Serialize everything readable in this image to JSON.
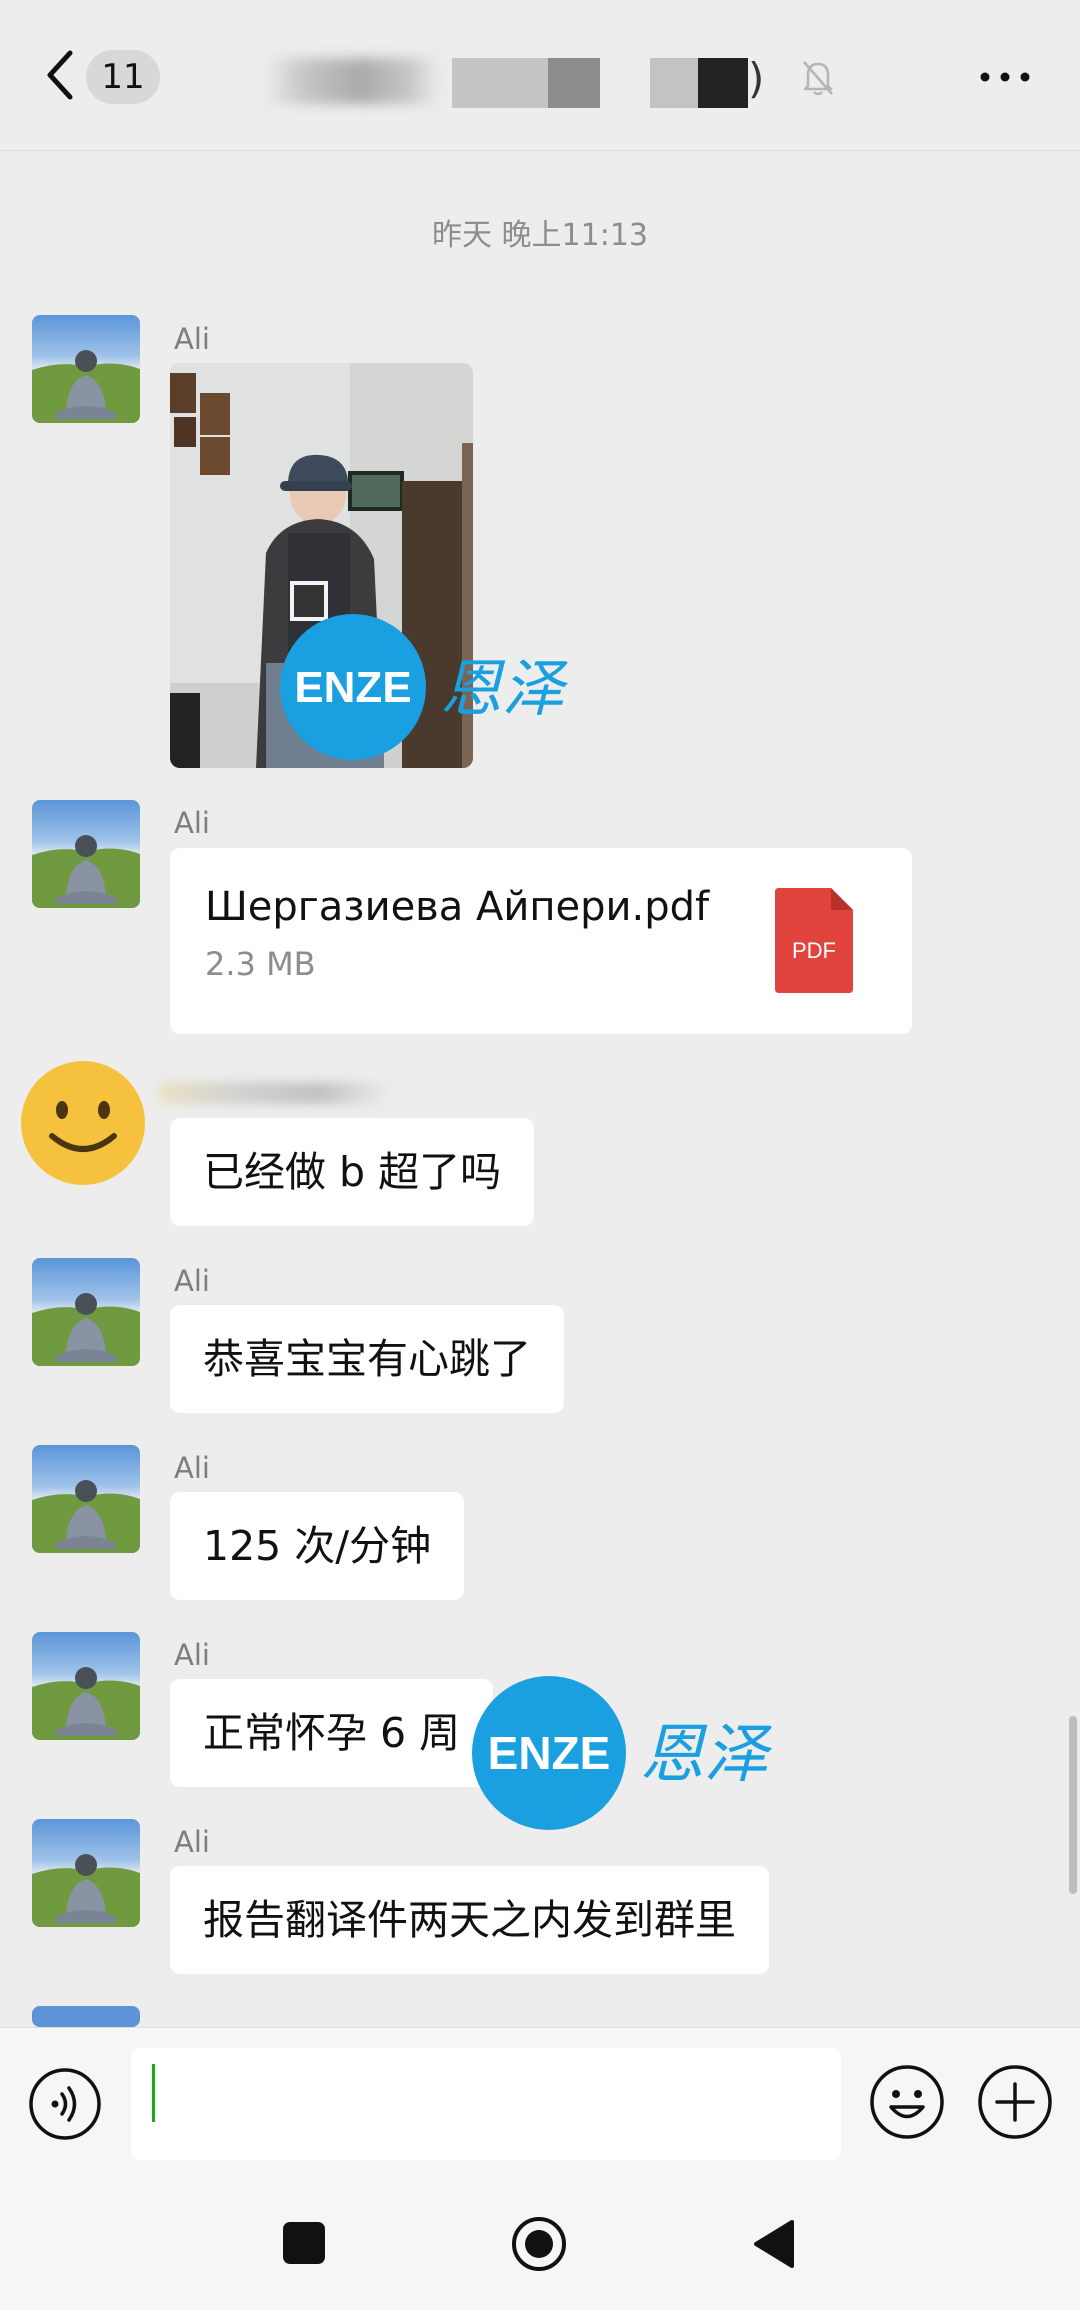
{
  "header": {
    "unread_count": "11",
    "title_suffix": ")"
  },
  "timestamp": "昨天 晚上11:13",
  "messages": [
    {
      "sender": "Ali",
      "type": "image"
    },
    {
      "sender": "Ali",
      "type": "file",
      "file_name": "Шергазиева Айпери.pdf",
      "file_size": "2.3 MB",
      "file_type": "PDF"
    },
    {
      "sender": "",
      "type": "text",
      "text": "已经做 b 超了吗"
    },
    {
      "sender": "Ali",
      "type": "text",
      "text": "恭喜宝宝有心跳了"
    },
    {
      "sender": "Ali",
      "type": "text",
      "text": "125 次/分钟"
    },
    {
      "sender": "Ali",
      "type": "text",
      "text": "正常怀孕 6 周"
    },
    {
      "sender": "Ali",
      "type": "text",
      "text": "报告翻译件两天之内发到群里"
    },
    {
      "sender": "Ali",
      "type": "partial"
    }
  ],
  "watermark": {
    "badge": "ENZE",
    "text": "恩泽",
    "badge_color": "#1a9fe0"
  },
  "input": {
    "value": ""
  },
  "icons": {
    "back": "chevron-left-icon",
    "mute": "bell-off-icon",
    "more": "more-dots-icon",
    "voice": "voice-icon",
    "emoji": "emoji-icon",
    "plus": "plus-icon",
    "file": "pdf-icon"
  },
  "colors": {
    "background": "#ededed",
    "bubble": "#ffffff",
    "pdf_red": "#e0443c",
    "caret_green": "#1aad19"
  }
}
